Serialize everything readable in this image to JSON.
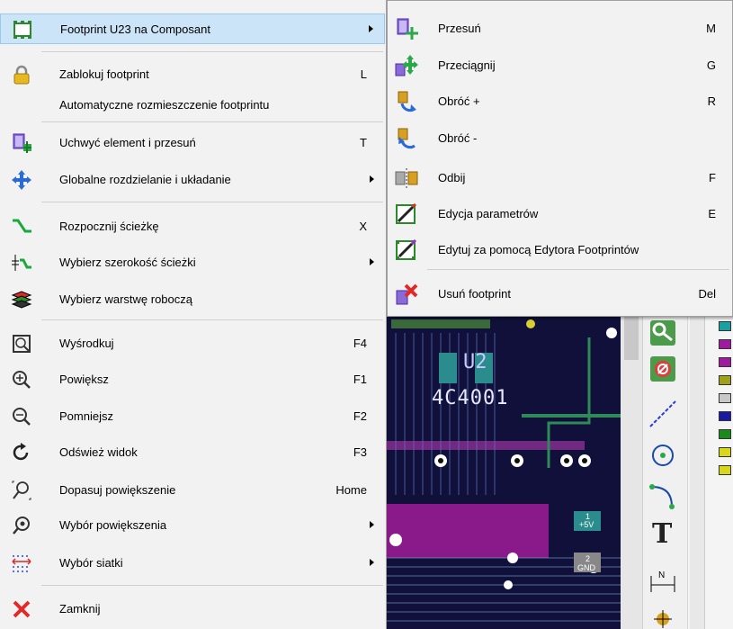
{
  "context_menu": {
    "items": [
      {
        "label": "Footprint U23 na Composant",
        "shortcut": "",
        "icon": "footprint-icon",
        "submenu": true
      },
      {
        "label": "Zablokuj footprint",
        "shortcut": "L",
        "icon": "lock-icon"
      },
      {
        "label": "Automatyczne rozmieszczenie footprintu",
        "shortcut": "",
        "icon": ""
      },
      {
        "label": "Uchwyć element i przesuń",
        "shortcut": "T",
        "icon": "grab-move-icon"
      },
      {
        "label": "Globalne rozdzielanie i układanie",
        "shortcut": "",
        "icon": "move-arrows-icon",
        "submenu": true
      },
      {
        "label": "Rozpocznij ścieżkę",
        "shortcut": "X",
        "icon": "track-icon"
      },
      {
        "label": "Wybierz szerokość ścieżki",
        "shortcut": "",
        "icon": "track-width-icon",
        "submenu": true
      },
      {
        "label": "Wybierz warstwę roboczą",
        "shortcut": "",
        "icon": "layers-icon"
      },
      {
        "label": "Wyśrodkuj",
        "shortcut": "F4",
        "icon": "center-icon"
      },
      {
        "label": "Powiększ",
        "shortcut": "F1",
        "icon": "zoom-in-icon"
      },
      {
        "label": "Pomniejsz",
        "shortcut": "F2",
        "icon": "zoom-out-icon"
      },
      {
        "label": "Odśwież widok",
        "shortcut": "F3",
        "icon": "refresh-icon"
      },
      {
        "label": "Dopasuj powiększenie",
        "shortcut": "Home",
        "icon": "zoom-fit-icon"
      },
      {
        "label": "Wybór powiększenia",
        "shortcut": "",
        "icon": "zoom-select-icon",
        "submenu": true
      },
      {
        "label": "Wybór siatki",
        "shortcut": "",
        "icon": "grid-icon",
        "submenu": true
      },
      {
        "label": "Zamknij",
        "shortcut": "",
        "icon": "close-icon"
      }
    ]
  },
  "submenu": {
    "items": [
      {
        "label": "Przesuń",
        "shortcut": "M",
        "icon": "move-icon"
      },
      {
        "label": "Przeciągnij",
        "shortcut": "G",
        "icon": "drag-icon"
      },
      {
        "label": "Obróć +",
        "shortcut": "R",
        "icon": "rotate-cw-icon"
      },
      {
        "label": "Obróć -",
        "shortcut": "",
        "icon": "rotate-ccw-icon"
      },
      {
        "label": "Odbij",
        "shortcut": "F",
        "icon": "flip-icon"
      },
      {
        "label": "Edycja parametrów",
        "shortcut": "E",
        "icon": "edit-icon"
      },
      {
        "label": "Edytuj za pomocą Edytora Footprintów",
        "shortcut": "",
        "icon": "footprint-editor-icon"
      },
      {
        "label": "Usuń footprint",
        "shortcut": "Del",
        "icon": "delete-icon"
      }
    ]
  },
  "pcb": {
    "ref_label": "U2",
    "value_label": "4C4001",
    "pin1_net": "+5V",
    "pin2_net": "GND",
    "pin1_num": "1",
    "pin2_num": "2"
  },
  "colors": {
    "menu_bg": "#f2f2f2",
    "highlight": "#cce4f7",
    "pcb_bg": "#10103a"
  }
}
